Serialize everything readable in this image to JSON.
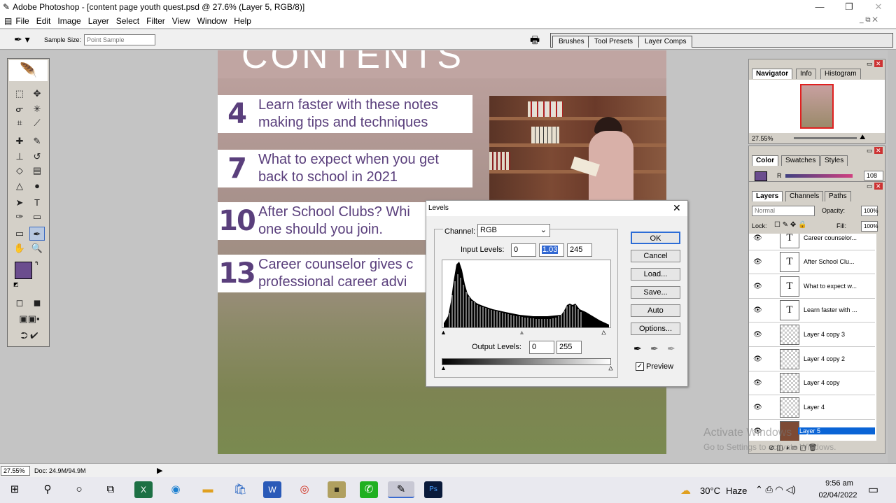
{
  "window": {
    "title": "Adobe Photoshop - [content page youth quest.psd @ 27.6% (Layer 5, RGB/8)]"
  },
  "menu": [
    "File",
    "Edit",
    "Image",
    "Layer",
    "Select",
    "Filter",
    "View",
    "Window",
    "Help"
  ],
  "options": {
    "sample_size_label": "Sample Size:",
    "sample_size_value": "Point Sample"
  },
  "palette_well": [
    "Brushes",
    "Tool Presets",
    "Layer Comps"
  ],
  "canvas": {
    "heading": "CONTENTS",
    "items": [
      {
        "num": "4",
        "line1": "Learn faster with these notes",
        "line2": "making tips and techniques"
      },
      {
        "num": "7",
        "line1": "What to expect when you get",
        "line2": "back to school in 2021"
      },
      {
        "num": "10",
        "line1": "After School Clubs? Whi",
        "line2": "one should you join."
      },
      {
        "num": "13",
        "line1": "Career counselor gives c",
        "line2": "professional career advi"
      }
    ]
  },
  "levels": {
    "title": "Levels",
    "channel_label": "Channel:",
    "channel_value": "RGB",
    "input_label": "Input Levels:",
    "input_black": "0",
    "input_gamma": "1.03",
    "input_white": "245",
    "output_label": "Output Levels:",
    "output_black": "0",
    "output_white": "255",
    "buttons": {
      "ok": "OK",
      "cancel": "Cancel",
      "load": "Load...",
      "save": "Save...",
      "auto": "Auto",
      "options": "Options..."
    },
    "preview_label": "Preview",
    "preview_checked": true
  },
  "navigator": {
    "tabs": [
      "Navigator",
      "Info",
      "Histogram"
    ],
    "zoom": "27.55%"
  },
  "color": {
    "tabs": [
      "Color",
      "Swatches",
      "Styles"
    ],
    "channel": "R",
    "value": "108",
    "swatch": "#6b4d8e"
  },
  "layers": {
    "tabs": [
      "Layers",
      "Channels",
      "Paths"
    ],
    "blend_mode": "Normal",
    "opacity_label": "Opacity:",
    "opacity": "100%",
    "lock_label": "Lock:",
    "fill_label": "Fill:",
    "fill": "100%",
    "items": [
      {
        "name": "Career counselor...",
        "type": "text",
        "selected": false
      },
      {
        "name": "After School Clu...",
        "type": "text",
        "selected": false
      },
      {
        "name": "What to expect w...",
        "type": "text",
        "selected": false
      },
      {
        "name": "Learn faster with ...",
        "type": "text",
        "selected": false
      },
      {
        "name": "Layer 4 copy 3",
        "type": "pixel",
        "selected": false
      },
      {
        "name": "Layer 4 copy 2",
        "type": "pixel",
        "selected": false
      },
      {
        "name": "Layer 4 copy",
        "type": "pixel",
        "selected": false
      },
      {
        "name": "Layer 4",
        "type": "pixel",
        "selected": false
      },
      {
        "name": "Layer 5",
        "type": "image",
        "selected": true
      }
    ]
  },
  "status": {
    "zoom": "27.55%",
    "doc": "Doc: 24.9M/94.9M"
  },
  "watermark": {
    "line1": "Activate Windows",
    "line2": "Go to Settings to activate Windows."
  },
  "taskbar": {
    "weather_temp": "30°C",
    "weather_desc": "Haze",
    "time": "9:56 am",
    "date": "02/04/2022"
  }
}
